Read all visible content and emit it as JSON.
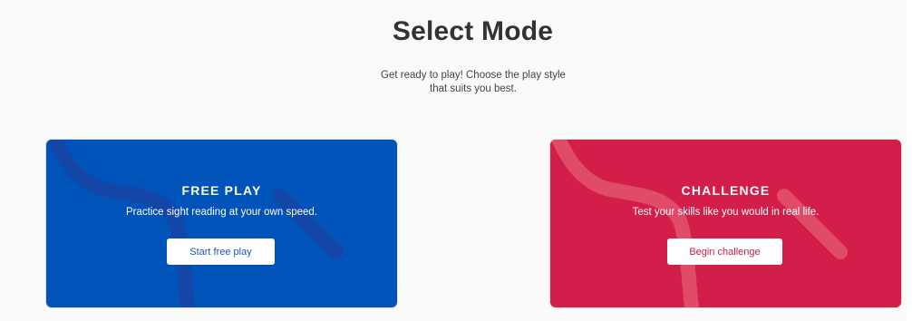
{
  "page": {
    "title": "Select Mode",
    "subtitle": "Get ready to play! Choose the play style that suits you best."
  },
  "modes": [
    {
      "title": "FREE PLAY",
      "description": "Practice sight reading at your own speed.",
      "button_label": "Start free play"
    },
    {
      "title": "CHALLENGE",
      "description": "Test your skills like you would in real life.",
      "button_label": "Begin challenge"
    }
  ],
  "colors": {
    "free_play": "#0053b8",
    "challenge": "#d31e4a",
    "background": "#fafafa"
  }
}
